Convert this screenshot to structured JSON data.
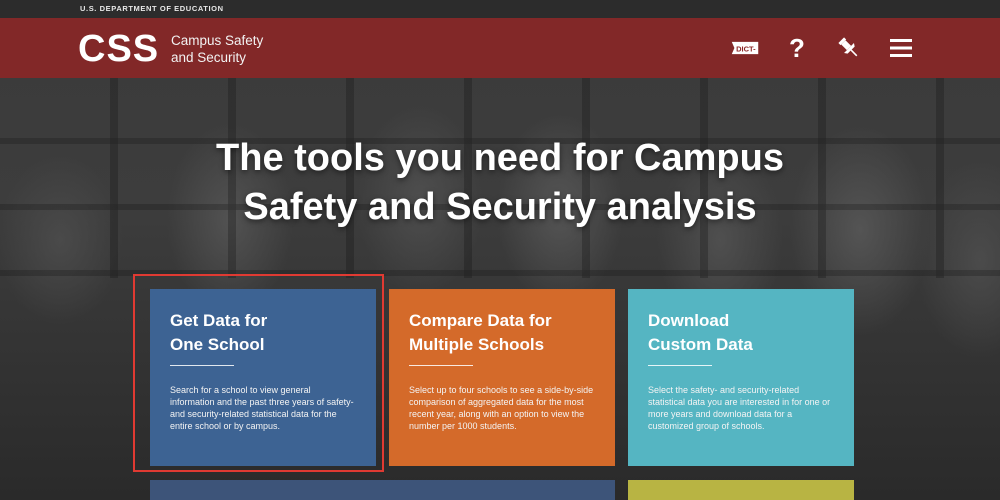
{
  "agency": "U.S. DEPARTMENT OF EDUCATION",
  "header": {
    "logo": "CSS",
    "subtitle_line1": "Campus Safety",
    "subtitle_line2": "and Security",
    "dict_label": "DICT-",
    "help_label": "?"
  },
  "hero": {
    "headline_line1": "The tools you need for Campus",
    "headline_line2": "Safety and Security analysis"
  },
  "cards": [
    {
      "title_line1": "Get Data for",
      "title_line2": "One School",
      "text": "Search for a school to view general information and the past three years of safety- and security-related statistical data for the entire school or by campus."
    },
    {
      "title_line1": "Compare Data for",
      "title_line2": "Multiple Schools",
      "text": "Select up to four schools to see a side-by-side comparison of aggregated data for the most recent year, along with an option to view the number per 1000 students."
    },
    {
      "title_line1": "Download",
      "title_line2": "Custom Data",
      "text": "Select the safety- and security-related statistical data you are interested in for one or more years and download data for a customized group of schools."
    }
  ],
  "icons": [
    "dictionary-icon",
    "help-icon",
    "pin-icon",
    "menu-icon"
  ],
  "colors": {
    "header": "#8c2626",
    "card_blue": "#3d6393",
    "card_orange": "#d46a2a",
    "card_teal": "#55b5c2",
    "highlight": "#e03a32"
  }
}
